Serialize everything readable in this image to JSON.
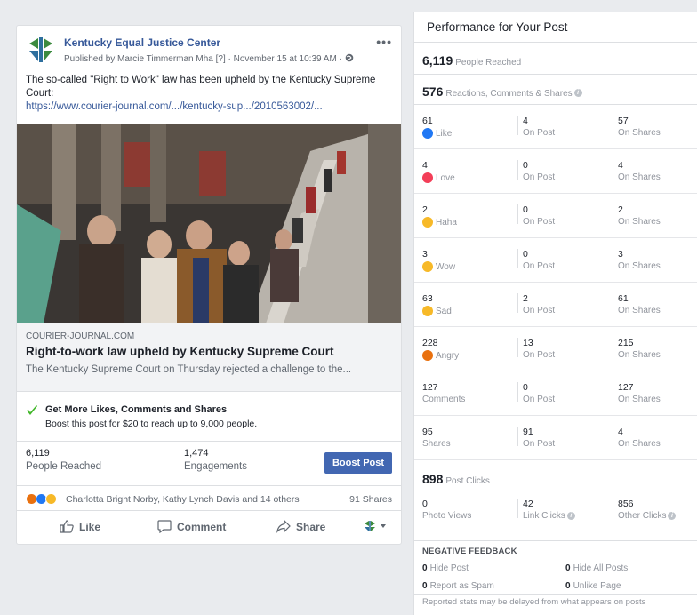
{
  "post": {
    "page_name": "Kentucky Equal Justice Center",
    "published_line": "Published by Marcie Timmerman Mha [?] · November 15 at 10:39 AM ·",
    "more": "•••",
    "text": "The so-called \"Right to Work\" law has been upheld by the Kentucky Supreme Court:",
    "url": "https://www.courier-journal.com/.../kentucky-sup.../2010563002/...",
    "link_domain": "COURIER-JOURNAL.COM",
    "link_title": "Right-to-work law upheld by Kentucky Supreme Court",
    "link_desc": "The Kentucky Supreme Court on Thursday rejected a challenge to the...",
    "promo_title": "Get More Likes, Comments and Shares",
    "promo_sub": "Boost this post for $20 to reach up to 9,000 people.",
    "stats": {
      "reached_num": "6,119",
      "reached_label": "People Reached",
      "engagements_num": "1,474",
      "engagements_label": "Engagements",
      "boost_button": "Boost Post"
    },
    "reactions_names": "Charlotta Bright Norby, Kathy Lynch Davis and 14 others",
    "shares_count": "91 Shares",
    "actions": {
      "like": "Like",
      "comment": "Comment",
      "share": "Share"
    }
  },
  "perf": {
    "title": "Performance for Your Post",
    "people_reached_num": "6,119",
    "people_reached_label": "People Reached",
    "rcs_num": "576",
    "rcs_label": "Reactions, Comments & Shares",
    "rows": [
      {
        "num": "61",
        "label": "Like",
        "on_post": "4",
        "on_shares": "57"
      },
      {
        "num": "4",
        "label": "Love",
        "on_post": "0",
        "on_shares": "4"
      },
      {
        "num": "2",
        "label": "Haha",
        "on_post": "0",
        "on_shares": "2"
      },
      {
        "num": "3",
        "label": "Wow",
        "on_post": "0",
        "on_shares": "3"
      },
      {
        "num": "63",
        "label": "Sad",
        "on_post": "2",
        "on_shares": "61"
      },
      {
        "num": "228",
        "label": "Angry",
        "on_post": "13",
        "on_shares": "215"
      },
      {
        "num": "127",
        "label": "Comments",
        "on_post": "0",
        "on_shares": "127"
      },
      {
        "num": "95",
        "label": "Shares",
        "on_post": "91",
        "on_shares": "4"
      }
    ],
    "on_post_label": "On Post",
    "on_shares_label": "On Shares",
    "post_clicks_num": "898",
    "post_clicks_label": "Post Clicks",
    "clicks": {
      "photo_views_num": "0",
      "photo_views_label": "Photo Views",
      "link_clicks_num": "42",
      "link_clicks_label": "Link Clicks",
      "other_clicks_num": "856",
      "other_clicks_label": "Other Clicks"
    },
    "negative_title": "NEGATIVE FEEDBACK",
    "negative": {
      "hide_post_num": "0",
      "hide_post_label": "Hide Post",
      "hide_all_num": "0",
      "hide_all_label": "Hide All Posts",
      "spam_num": "0",
      "spam_label": "Report as Spam",
      "unlike_num": "0",
      "unlike_label": "Unlike Page"
    },
    "footer": "Reported stats may be delayed from what appears on posts"
  },
  "colors": {
    "accent": "#4267b2",
    "link": "#365899",
    "like": "#2078f4",
    "love": "#f33e58",
    "react_yellow": "#f7b928",
    "angry": "#e9710f"
  }
}
